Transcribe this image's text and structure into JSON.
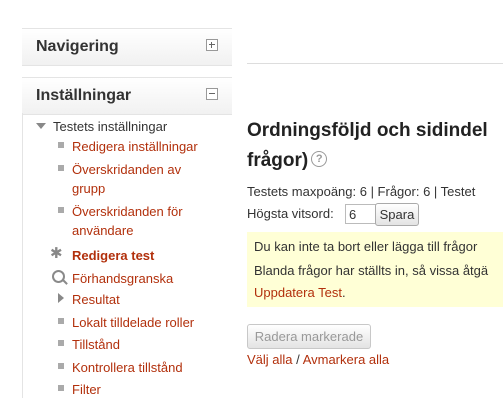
{
  "navigation_block": {
    "title": "Navigering"
  },
  "settings_block": {
    "title": "Inställningar",
    "root": "Testets inställningar",
    "items": [
      {
        "label": "Redigera inställningar",
        "line2": ""
      },
      {
        "label": "Överskridanden av",
        "line2": "grupp"
      },
      {
        "label": "Överskridanden för",
        "line2": "användare"
      },
      {
        "label": "Redigera test",
        "line2": ""
      },
      {
        "label": "Förhandsgranska",
        "line2": ""
      },
      {
        "label": "Resultat",
        "line2": ""
      },
      {
        "label": "Lokalt tilldelade roller",
        "line2": ""
      },
      {
        "label": "Tillstånd",
        "line2": ""
      },
      {
        "label": "Kontrollera tillstånd",
        "line2": ""
      },
      {
        "label": "Filter",
        "line2": ""
      }
    ]
  },
  "main": {
    "heading_line1": "Ordningsföljd och sidindel",
    "heading_line2": "frågor)",
    "info": "Testets maxpoäng: 6 | Frågor: 6 | Testet",
    "grade_label": "Högsta vitsord:",
    "grade_value": "6",
    "save_label": "Spara",
    "notice_line1": "Du kan inte ta bort eller lägga till frågor",
    "notice_line2": "Blanda frågor har ställts in, så vissa åtgä",
    "notice_link": "Uppdatera Test",
    "notice_period": ".",
    "delete_label": "Radera markerade",
    "select_all": "Välj alla",
    "separator": "/",
    "deselect_all": "Avmarkera alla"
  },
  "colors": {
    "link": "#b2300c",
    "notice_bg": "#ffffd6"
  },
  "icons": [
    "plus-icon",
    "minus-icon",
    "expanded-icon",
    "gear-icon",
    "magnifier-icon",
    "collapsed-icon",
    "help-icon"
  ]
}
